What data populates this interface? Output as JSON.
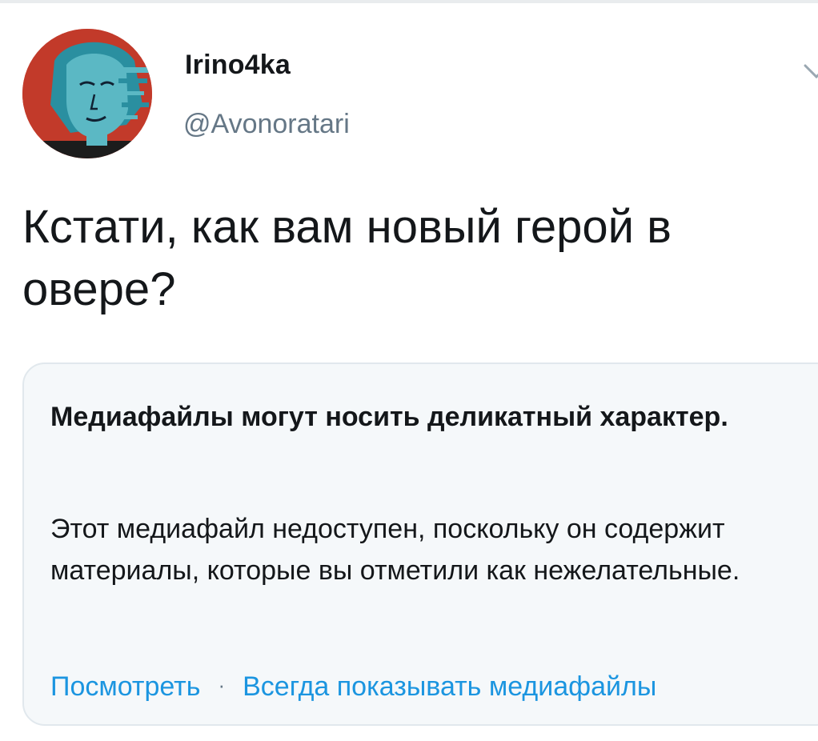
{
  "tweet": {
    "author": {
      "display_name": "Irino4ka",
      "handle": "@Avonoratari"
    },
    "text": "Кстати, как вам новый герой в овере?",
    "media_warning": {
      "title": "Медиафайлы могут носить деликатный характер.",
      "body": "Этот медиафайл недоступен, поскольку он содержит материалы, которые вы отметили как нежелательные.",
      "view_label": "Посмотреть",
      "separator": "·",
      "always_show_label": "Всегда показывать медиафайлы"
    }
  },
  "colors": {
    "text_primary": "#14171a",
    "text_secondary": "#657786",
    "link": "#1b95e0",
    "card_background": "#f5f8fa",
    "card_border": "#e1e8ed",
    "avatar_background": "#c23a2a"
  },
  "icons": {
    "menu": "chevron-down-icon"
  }
}
